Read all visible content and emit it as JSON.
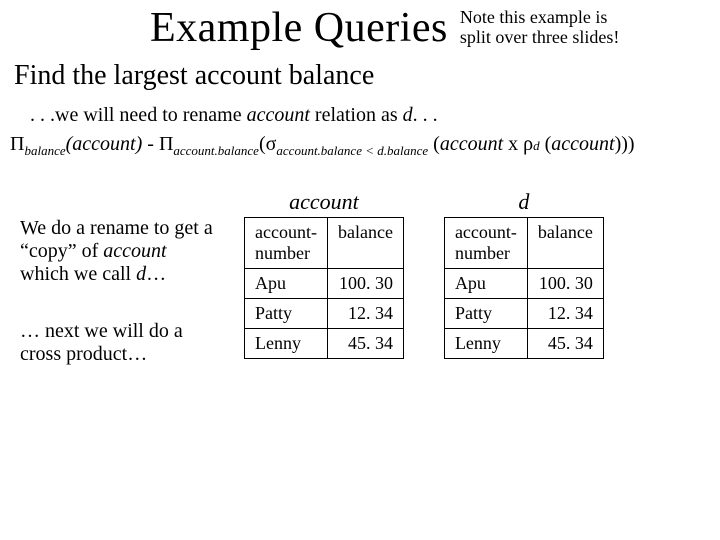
{
  "title": "Example Queries",
  "note_line1": "Note this example is",
  "note_line2": "split over three slides!",
  "subtitle": "Find the largest account balance",
  "rename_prefix": ". . .we will need to rename ",
  "rename_word_account": "account",
  "rename_mid": " relation as ",
  "rename_word_d": "d",
  "rename_suffix": ". . .",
  "formula": {
    "pi": "Π",
    "sigma": "σ",
    "rho": "ρ",
    "sub_balance": "balance",
    "account_it": "account",
    "minus": " - ",
    "sub_acct_bal": "account.balance",
    "sub_cond": "account.balance < d.balance",
    "times": " x ",
    "sub_d": "d",
    "open": "(",
    "close": ")",
    "close3": ")))"
  },
  "side": {
    "p1a": "We do a rename to get a “copy” of ",
    "p1_account": "account",
    "p1b": " which we call ",
    "p1_d": "d",
    "p1c": "…",
    "p2": "… next we will do a cross product…"
  },
  "table_headers": {
    "col1": "account-number",
    "col2": "balance"
  },
  "table_names": {
    "left": "account",
    "right": "d"
  },
  "rows": [
    {
      "name": "Apu",
      "bal": "100. 30"
    },
    {
      "name": "Patty",
      "bal": "12. 34"
    },
    {
      "name": "Lenny",
      "bal": "45. 34"
    }
  ],
  "chart_data": {
    "type": "table",
    "tables": [
      {
        "name": "account",
        "columns": [
          "account-number",
          "balance"
        ],
        "rows": [
          [
            "Apu",
            100.3
          ],
          [
            "Patty",
            12.34
          ],
          [
            "Lenny",
            45.34
          ]
        ]
      },
      {
        "name": "d",
        "columns": [
          "account-number",
          "balance"
        ],
        "rows": [
          [
            "Apu",
            100.3
          ],
          [
            "Patty",
            12.34
          ],
          [
            "Lenny",
            45.34
          ]
        ]
      }
    ]
  }
}
